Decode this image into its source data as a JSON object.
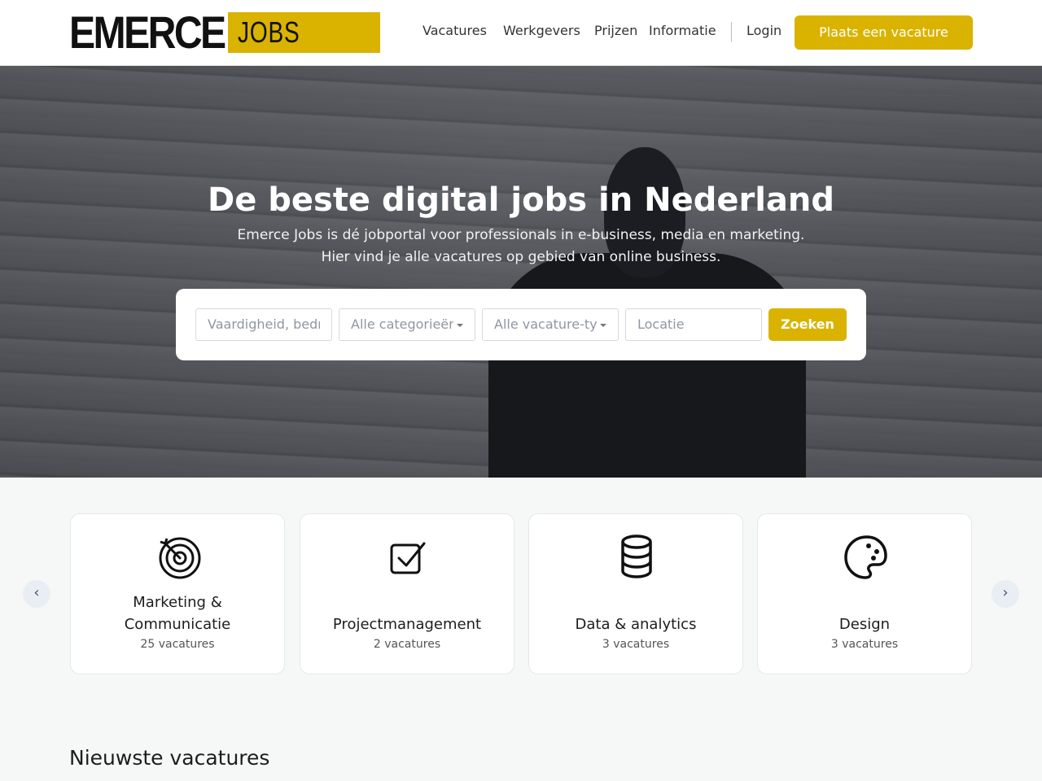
{
  "header": {
    "logo_main": "EMERCE",
    "logo_jobs": "JOBS",
    "nav": [
      "Vacatures",
      "Werkgevers",
      "Prijzen",
      "Informatie"
    ],
    "login": "Login",
    "post_button": "Plaats een vacature",
    "accent_color": "#d9b300"
  },
  "hero": {
    "title": "De beste digital jobs in Nederland",
    "subtitle_1": "Emerce Jobs is dé jobportal voor professionals in e-business, media en marketing.",
    "subtitle_2": "Hier vind je alle vacatures op gebied van online business."
  },
  "search": {
    "keyword_placeholder": "Vaardigheid, bedrijf, functie",
    "category_value": "Alle categorieën",
    "type_value": "Alle vacature-types",
    "location_placeholder": "Locatie",
    "button": "Zoeken"
  },
  "categories": [
    {
      "name_1": "Marketing &",
      "name_2": "Communicatie",
      "count": "25 vacatures",
      "icon": "target-icon"
    },
    {
      "name_1": "",
      "name_2": "Projectmanagement",
      "count": "2 vacatures",
      "icon": "checkbox-icon"
    },
    {
      "name_1": "",
      "name_2": "Data & analytics",
      "count": "3 vacatures",
      "icon": "database-icon"
    },
    {
      "name_1": "",
      "name_2": "Design",
      "count": "3 vacatures",
      "icon": "palette-icon"
    }
  ],
  "carousel": {
    "prev": "‹",
    "next": "›"
  },
  "latest": {
    "title": "Nieuwste vacatures"
  }
}
